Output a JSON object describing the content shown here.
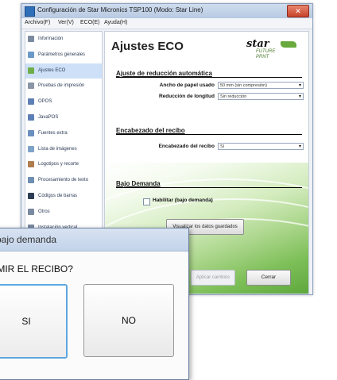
{
  "window": {
    "title": "Configuración de Star Micronics TSP100 (Modo: Star Line)",
    "close_label": "✕"
  },
  "menu": [
    "Archivo(F)",
    "Ver(V)",
    "ECO(E)",
    "Ayuda(H)"
  ],
  "sidebar": {
    "items": [
      {
        "label": "Información",
        "icon": "info-icon",
        "color": "#7a8aa0"
      },
      {
        "label": "Parámetros generales",
        "icon": "settings-icon",
        "color": "#6c9ac8"
      },
      {
        "label": "Ajustes ECO",
        "icon": "eco-icon",
        "color": "#6fae4a",
        "selected": true
      },
      {
        "label": "Pruebas de impresión",
        "icon": "printer-icon",
        "color": "#8a95a6"
      },
      {
        "label": "OPOS",
        "icon": "opos-icon",
        "color": "#5d7fb5"
      },
      {
        "label": "JavaPOS",
        "icon": "java-icon",
        "color": "#5d7fb5"
      },
      {
        "label": "Fuentes extra",
        "icon": "font-icon",
        "color": "#6b8fbf"
      },
      {
        "label": "Lista de imágenes",
        "icon": "image-icon",
        "color": "#7fa2c8"
      },
      {
        "label": "Logotipos y recorte",
        "icon": "logo-icon",
        "color": "#b07d4f"
      },
      {
        "label": "Procesamiento de texto",
        "icon": "text-icon",
        "color": "#6f8fb2"
      },
      {
        "label": "Códigos de barras",
        "icon": "barcode-icon",
        "color": "#2d3d55"
      },
      {
        "label": "Otros",
        "icon": "misc-icon",
        "color": "#7a8aa0"
      },
      {
        "label": "Instalación vertical",
        "icon": "vertical-icon",
        "color": "#7a8aa0"
      }
    ]
  },
  "main": {
    "title": "Ajustes ECO",
    "logo_word": "star",
    "logo_sub": "FUTURE",
    "logo_sub2": "PRNT",
    "auto_reduction_title": "Ajuste de reducción automática",
    "paper_width_label": "Ancho de papel usado",
    "paper_width_value": "50 mm (sin compresión)",
    "length_reduction_label": "Reducción de longitud",
    "length_reduction_value": "Sin reducción",
    "receipt_header_title": "Encabezado del recibo",
    "receipt_header_label": "Encabezado del recibo",
    "receipt_header_value": "Sí",
    "on_demand_title": "Bajo Demanda",
    "on_demand_checkbox_label": "Habilitar (bajo demanda)",
    "on_demand_checked": false,
    "view_saved_label": "Visualizar los datos guardados",
    "apply_label": "Aplicar cambios",
    "close_label": "Cerrar"
  },
  "dialog": {
    "title": "bajo demanda",
    "question": "IMIR EL RECIBO?",
    "yes_label": "SI",
    "no_label": "NO"
  },
  "colors": {
    "accent_blue": "#5da7e0",
    "eco_green": "#6fae4a"
  }
}
